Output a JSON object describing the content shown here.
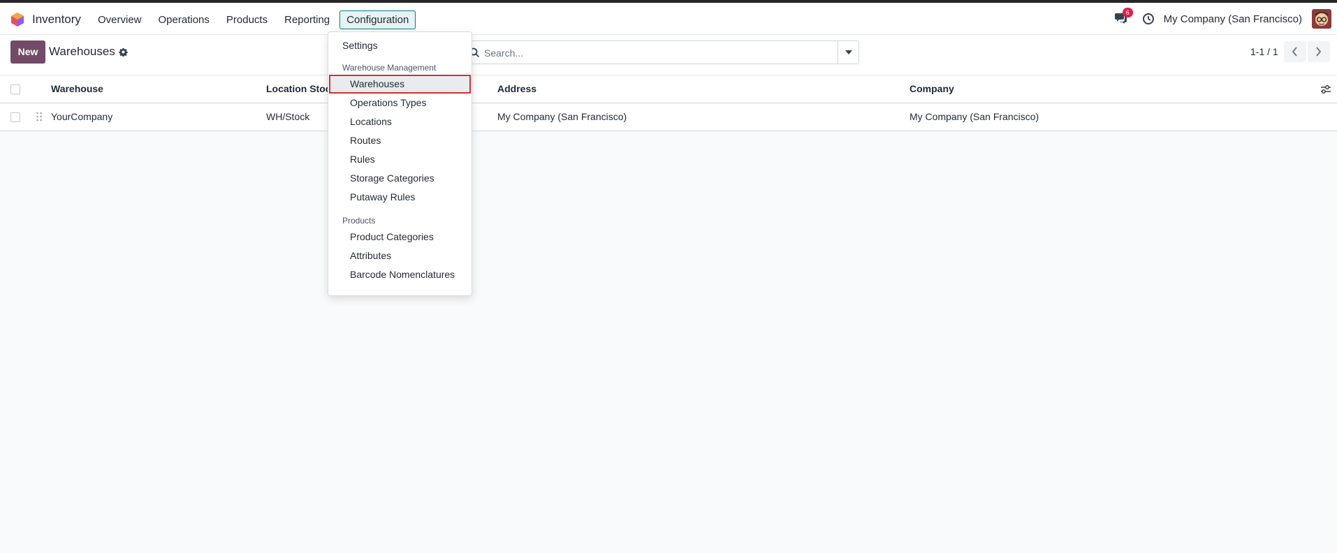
{
  "app": {
    "name": "Inventory",
    "logo_colors": [
      "#e0526b",
      "#f3a53b",
      "#8b5cf6"
    ]
  },
  "nav": {
    "items": [
      {
        "label": "Overview"
      },
      {
        "label": "Operations"
      },
      {
        "label": "Products"
      },
      {
        "label": "Reporting"
      },
      {
        "label": "Configuration",
        "active": true
      }
    ]
  },
  "systray": {
    "messages_badge": "6",
    "company": "My Company (San Francisco)"
  },
  "control_panel": {
    "new_label": "New",
    "breadcrumb": "Warehouses",
    "search_placeholder": "Search...",
    "pager": "1-1 / 1"
  },
  "table": {
    "columns": [
      "Warehouse",
      "Location Stock",
      "Address",
      "Company"
    ],
    "rows": [
      {
        "warehouse": "YourCompany",
        "location_stock": "WH/Stock",
        "address": "My Company (San Francisco)",
        "company": "My Company (San Francisco)"
      }
    ]
  },
  "dropdown": {
    "settings_label": "Settings",
    "sections": [
      {
        "header": "Warehouse Management",
        "items": [
          "Warehouses",
          "Operations Types",
          "Locations",
          "Routes",
          "Rules",
          "Storage Categories",
          "Putaway Rules"
        ]
      },
      {
        "header": "Products",
        "items": [
          "Product Categories",
          "Attributes",
          "Barcode Nomenclatures"
        ]
      }
    ],
    "selected": "Warehouses"
  },
  "colors": {
    "brand": "#714b67",
    "active_nav_border": "#017e84",
    "badge": "#e11d48",
    "highlight_outline": "#d32f2f"
  }
}
